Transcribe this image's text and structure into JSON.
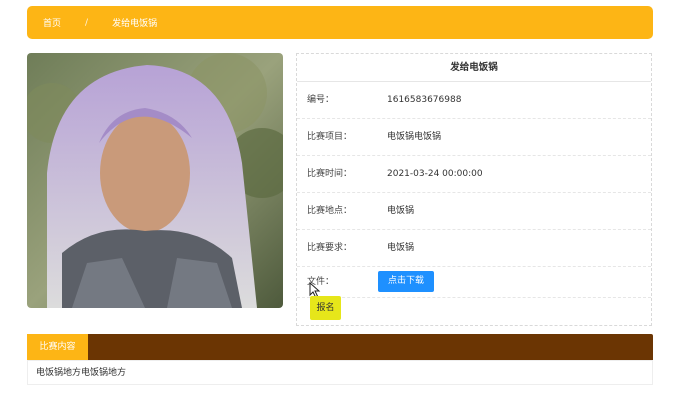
{
  "breadcrumb": {
    "home": "首页",
    "separator": "/",
    "current": "发给电饭锅"
  },
  "detail": {
    "title": "发给电饭锅",
    "fields": [
      {
        "label": "编号：",
        "value": "1616583676988"
      },
      {
        "label": "比赛项目：",
        "value": "电饭锅电饭锅"
      },
      {
        "label": "比赛时间：",
        "value": "2021-03-24 00:00:00"
      },
      {
        "label": "比赛地点：",
        "value": "电饭锅"
      },
      {
        "label": "比赛要求：",
        "value": "电饭锅"
      }
    ],
    "file_label": "文件：",
    "download_label": "点击下载",
    "signup_label": "报名"
  },
  "content": {
    "tab_label": "比赛内容",
    "text": "电饭锅地方电饭锅地方"
  },
  "colors": {
    "accent": "#fdb515",
    "content_bar": "#6b3503",
    "download": "#1e90ff",
    "signup": "#e6e61a"
  }
}
